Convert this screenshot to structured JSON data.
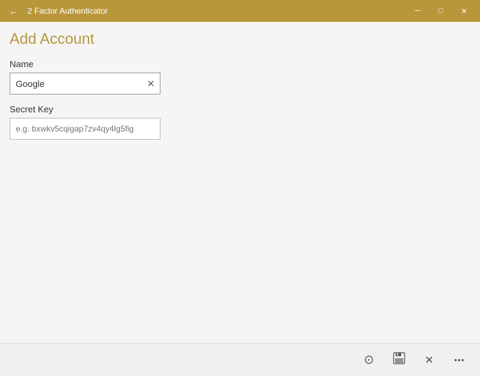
{
  "titleBar": {
    "appName": "2 Factor Authenticator",
    "backIcon": "←",
    "minimizeIcon": "─",
    "maximizeIcon": "□",
    "closeIcon": "✕"
  },
  "page": {
    "title": "Add Account"
  },
  "form": {
    "nameLabel": "Name",
    "nameValue": "Google",
    "namePlaceholder": "",
    "secretKeyLabel": "Secret Key",
    "secretKeyValue": "",
    "secretKeyPlaceholder": "e.g. bxwkv5cqigap7zv4qy4lg5fig"
  },
  "bottomBar": {
    "cameraIcon": "⊙",
    "saveIcon": "💾",
    "cancelIcon": "✕",
    "moreIcon": "•••"
  }
}
